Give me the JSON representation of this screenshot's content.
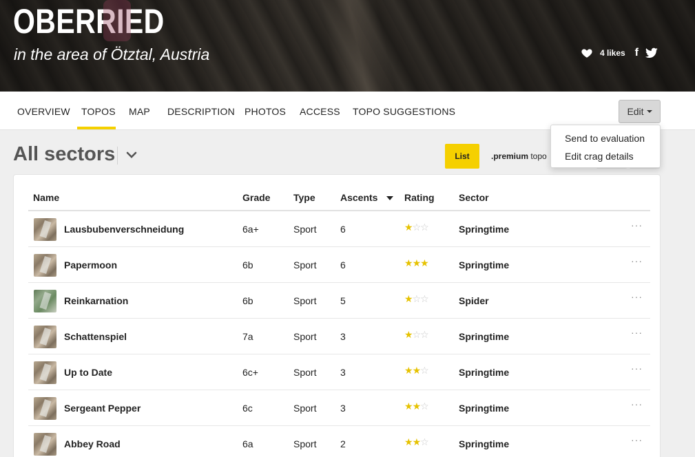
{
  "hero": {
    "title": "OBERRIED",
    "subtitle": "in the area of Ötztal, Austria",
    "likes": "4 likes",
    "facebook_glyph": "f"
  },
  "nav": {
    "tabs": [
      "OVERVIEW",
      "TOPOS",
      "MAP",
      "DESCRIPTION",
      "PHOTOS",
      "ACCESS",
      "TOPO SUGGESTIONS"
    ],
    "active_tab": "TOPOS",
    "edit_label": "Edit"
  },
  "dropdown": {
    "items": [
      "Send to evaluation",
      "Edit crag details"
    ]
  },
  "toolbar": {
    "sectors_title": "All sectors",
    "list_label": "List",
    "premium_bold": ".premium",
    "premium_rest": " topo"
  },
  "table": {
    "headers": {
      "name": "Name",
      "grade": "Grade",
      "type": "Type",
      "ascents": "Ascents",
      "rating": "Rating",
      "sector": "Sector"
    },
    "rows": [
      {
        "name": "Lausbubenverschneidung",
        "grade": "6a+",
        "type": "Sport",
        "ascents": "6",
        "rating": 1,
        "sector": "Springtime",
        "thumb": "rock"
      },
      {
        "name": "Papermoon",
        "grade": "6b",
        "type": "Sport",
        "ascents": "6",
        "rating": 3,
        "sector": "Springtime",
        "thumb": "rock"
      },
      {
        "name": "Reinkarnation",
        "grade": "6b",
        "type": "Sport",
        "ascents": "5",
        "rating": 1,
        "sector": "Spider",
        "thumb": "green"
      },
      {
        "name": "Schattenspiel",
        "grade": "7a",
        "type": "Sport",
        "ascents": "3",
        "rating": 1,
        "sector": "Springtime",
        "thumb": "rock"
      },
      {
        "name": "Up to Date",
        "grade": "6c+",
        "type": "Sport",
        "ascents": "3",
        "rating": 2,
        "sector": "Springtime",
        "thumb": "rock"
      },
      {
        "name": "Sergeant Pepper",
        "grade": "6c",
        "type": "Sport",
        "ascents": "3",
        "rating": 2,
        "sector": "Springtime",
        "thumb": "rock"
      },
      {
        "name": "Abbey Road",
        "grade": "6a",
        "type": "Sport",
        "ascents": "2",
        "rating": 2,
        "sector": "Springtime",
        "thumb": "rock"
      }
    ],
    "more_glyph": "···"
  },
  "colors": {
    "accent": "#f5d000",
    "star_on": "#e6c200",
    "star_off": "#c8c8c8"
  }
}
